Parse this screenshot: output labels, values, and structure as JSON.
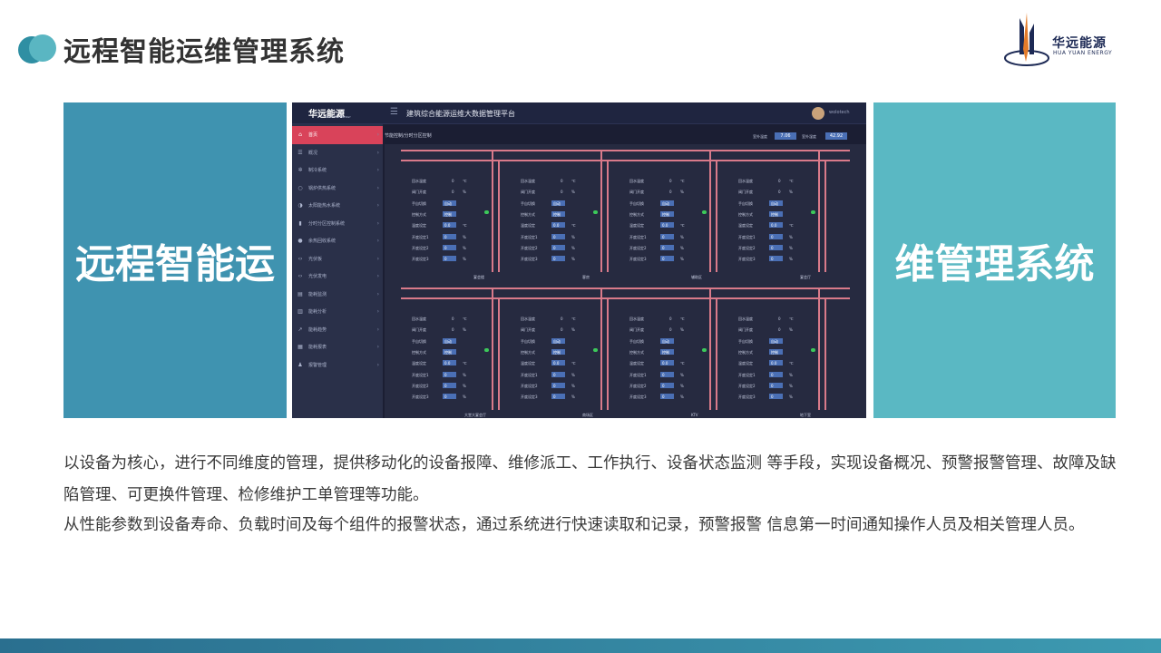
{
  "header": {
    "title": "远程智能运维管理系统",
    "logo_cn": "华远能源",
    "logo_en": "HUA YUAN ENERGY"
  },
  "panels": {
    "left_text": "远程智能运",
    "right_text": "维管理系统"
  },
  "screenshot": {
    "brand": "华远能源",
    "brand_sub": "HUA YUAN ENERGY",
    "app_title": "建筑综合能源运维大数据管理平台",
    "user": "wolotech",
    "breadcrumb": "节能控制/分时分区控制",
    "indicators": [
      {
        "label": "室外温度",
        "value": "7.06"
      },
      {
        "label": "室外湿度",
        "value": "42.92"
      }
    ],
    "nav": [
      {
        "icon": "home-icon",
        "label": "首页"
      },
      {
        "icon": "list-icon",
        "label": "概况"
      },
      {
        "icon": "gear-icon",
        "label": "制冷系统"
      },
      {
        "icon": "circle-icon",
        "label": "锅炉供热系统"
      },
      {
        "icon": "halfmoon-icon",
        "label": "太阳能热水系统"
      },
      {
        "icon": "thermo-icon",
        "label": "分时分区控制系统"
      },
      {
        "icon": "dot-icon",
        "label": "余热回收系统"
      },
      {
        "icon": "code-icon",
        "label": "光伏板"
      },
      {
        "icon": "code-icon",
        "label": "光伏发电"
      },
      {
        "icon": "book-icon",
        "label": "能耗监测"
      },
      {
        "icon": "chart-icon",
        "label": "能耗分析"
      },
      {
        "icon": "trend-icon",
        "label": "能耗趋势"
      },
      {
        "icon": "report-icon",
        "label": "能耗报表"
      },
      {
        "icon": "user-icon",
        "label": "报警管理"
      }
    ],
    "unit_labels": [
      "回水温度",
      "阀门开度",
      "手自切换",
      "控制方式",
      "温度设定",
      "开度设定1",
      "开度设定2",
      "开度设定3"
    ],
    "unit_values": {
      "temp": "0",
      "opening": "0",
      "setpoint": "0.0",
      "unit_c": "℃",
      "unit_pct": "%",
      "mode_auto": "自动",
      "mode_ctrl": "控制"
    },
    "rooms_top": [
      "宴会楼",
      "客房",
      "辅助区",
      "宴会厅"
    ],
    "rooms_bottom": [
      "大堂大宴会厅",
      "商场区",
      "KTV",
      "地下室"
    ]
  },
  "body": {
    "para1": "以设备为核心，进行不同维度的管理，提供移动化的设备报障、维修派工、工作执行、设备状态监测 等手段，实现设备概况、预警报警管理、故障及缺陷管理、可更换件管理、检修维护工单管理等功能。",
    "para2": "从性能参数到设备寿命、负载时间及每个组件的报警状态，通过系统进行快速读取和记录，预警报警 信息第一时间通知操作人员及相关管理人员。"
  }
}
